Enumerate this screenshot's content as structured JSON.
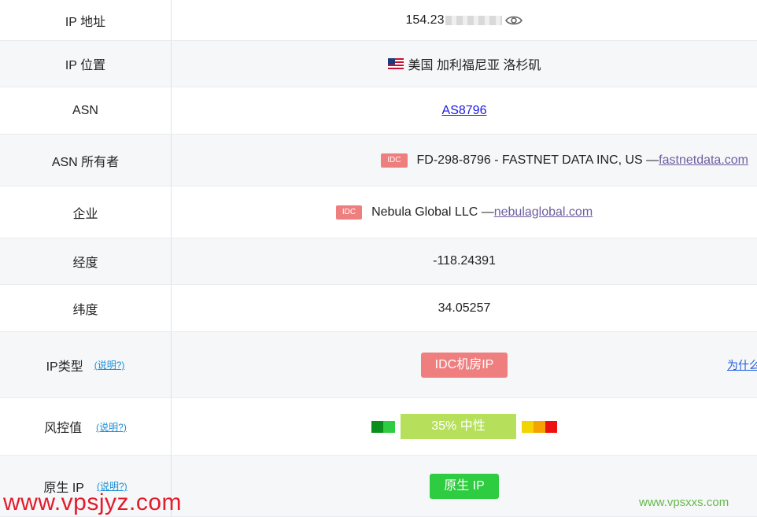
{
  "rows": {
    "ip_address": {
      "label": "IP 地址",
      "value": "154.23",
      "eye_icon": "eye-icon"
    },
    "ip_location": {
      "label": "IP 位置",
      "value": "美国 加利福尼亚 洛杉矶",
      "flag_icon": "us-flag-icon"
    },
    "asn": {
      "label": "ASN",
      "value": "AS8796"
    },
    "asn_owner": {
      "label": "ASN 所有者",
      "tag": "IDC",
      "value": "FD-298-8796 - FASTNET DATA INC, US —",
      "domain": "fastnetdata.com"
    },
    "company": {
      "label": "企业",
      "tag": "IDC",
      "value": "Nebula Global LLC —",
      "domain": "nebulaglobal.com"
    },
    "longitude": {
      "label": "经度",
      "value": "-118.24391"
    },
    "latitude": {
      "label": "纬度",
      "value": "34.05257"
    },
    "ip_type": {
      "label": "IP类型",
      "help": "(说明?)",
      "badge": "IDC机房IP",
      "why_link": "为什么"
    },
    "risk": {
      "label": "风控值",
      "help": "(说明?)",
      "badge": "35%   中性",
      "percent": 35
    },
    "native_ip": {
      "label": "原生 IP",
      "help": "(说明?)",
      "badge": "原生 IP"
    }
  },
  "colors": {
    "row_alt_bg": "#f6f7f9",
    "idc_tag": "#ee7f7f",
    "risk_badge": "#b6e05c",
    "risk_low_dark": "#0a8f1d",
    "risk_low_light": "#2ecc40",
    "risk_high_1": "#f2d500",
    "risk_high_2": "#f5a300",
    "risk_high_3": "#ee1111",
    "native_badge": "#2ecc40"
  },
  "watermarks": {
    "left": "www.vpsjyz.com",
    "right": "www.vpsxxs.com"
  }
}
